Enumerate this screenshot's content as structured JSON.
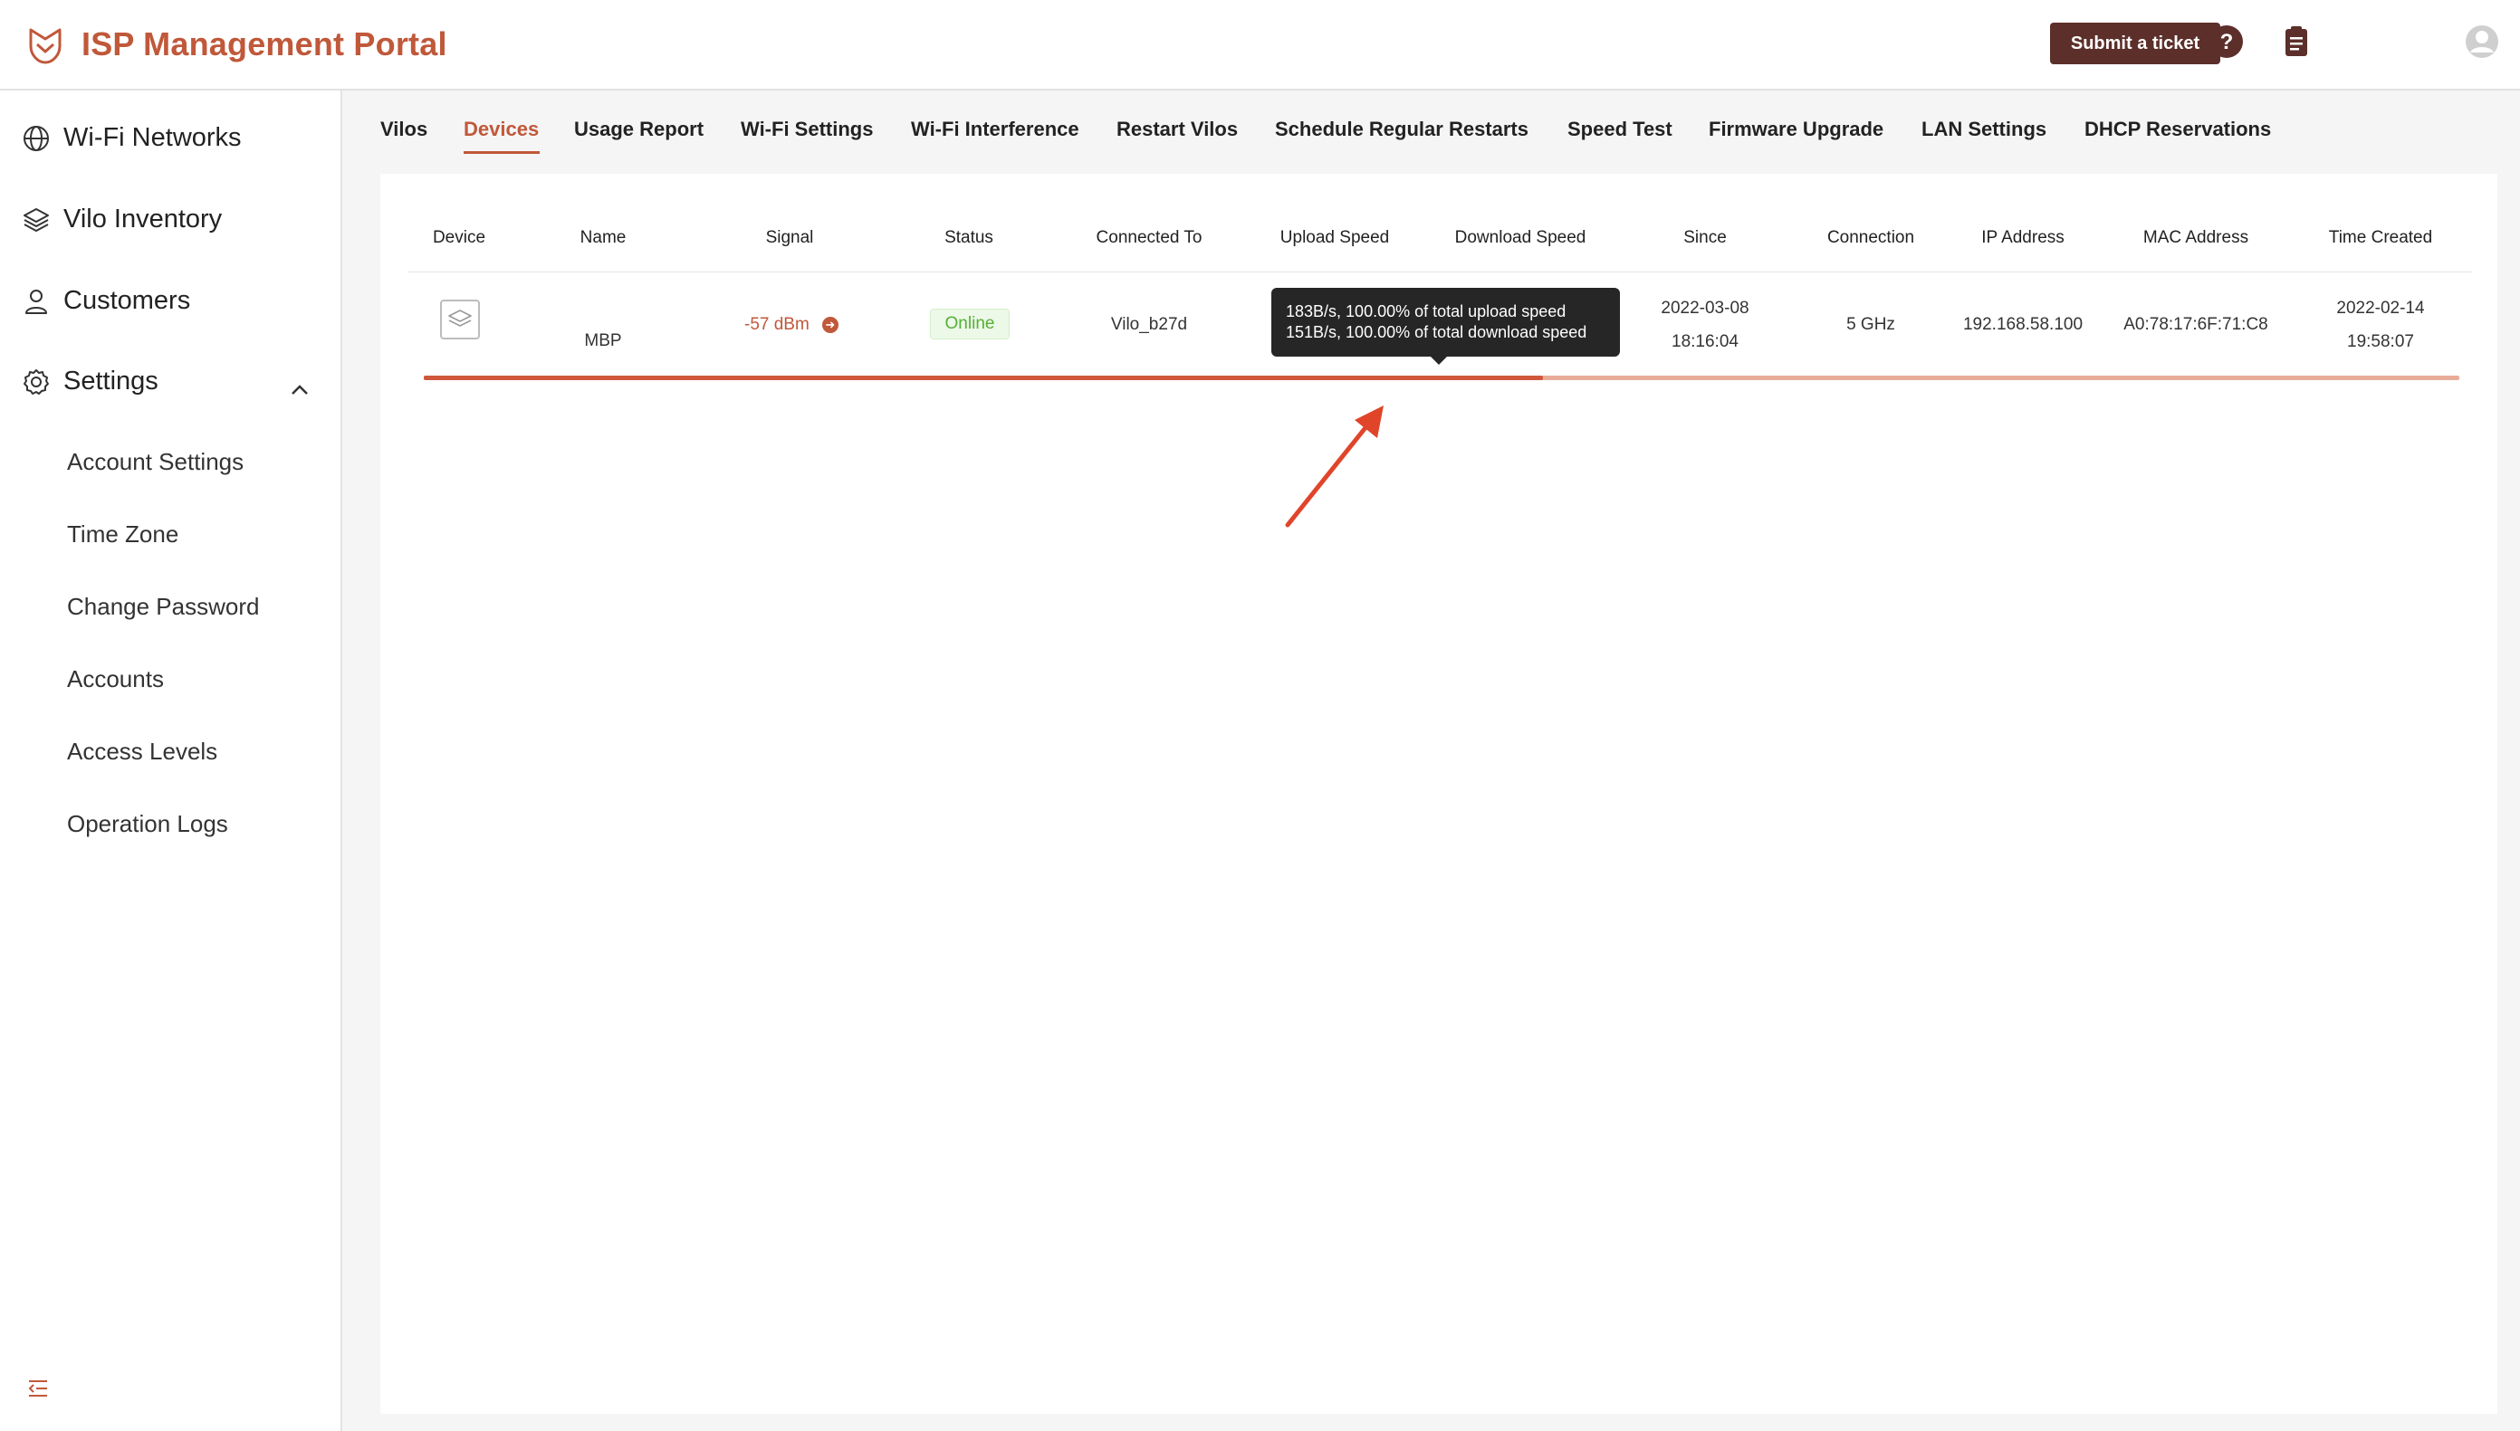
{
  "app": {
    "title": "ISP Management Portal",
    "logo_icon": "fox-logo-icon"
  },
  "header": {
    "submit_ticket_label": "Submit a ticket",
    "icons": [
      "help-circle-icon",
      "clipboard-icon",
      "user-avatar-icon"
    ]
  },
  "sidebar": {
    "items": [
      {
        "label": "Wi-Fi Networks",
        "icon": "globe-icon"
      },
      {
        "label": "Vilo Inventory",
        "icon": "layers-icon"
      },
      {
        "label": "Customers",
        "icon": "person-icon"
      },
      {
        "label": "Settings",
        "icon": "gear-icon",
        "expanded": true
      }
    ],
    "settings_sub": [
      {
        "label": "Account Settings"
      },
      {
        "label": "Time Zone"
      },
      {
        "label": "Change Password"
      },
      {
        "label": "Accounts"
      },
      {
        "label": "Access Levels"
      },
      {
        "label": "Operation Logs"
      }
    ],
    "collapse_icon": "menu-collapse-icon"
  },
  "tabs": {
    "items": [
      {
        "label": "Vilos"
      },
      {
        "label": "Devices",
        "active": true
      },
      {
        "label": "Usage Report"
      },
      {
        "label": "Wi-Fi Settings"
      },
      {
        "label": "Wi-Fi Interference"
      },
      {
        "label": "Restart Vilos"
      },
      {
        "label": "Schedule Regular Restarts"
      },
      {
        "label": "Speed Test"
      },
      {
        "label": "Firmware Upgrade"
      },
      {
        "label": "LAN Settings"
      },
      {
        "label": "DHCP Reservations"
      }
    ]
  },
  "table": {
    "columns": [
      "Device",
      "Name",
      "Signal",
      "Status",
      "Connected To",
      "Upload Speed",
      "Download Speed",
      "Since",
      "Connection",
      "IP Address",
      "MAC Address",
      "Time Created"
    ],
    "rows": [
      {
        "device_icon": "device-layers-icon",
        "name": "MBP",
        "signal": "-57 dBm",
        "status": "Online",
        "connected_to": "Vilo_b27d",
        "since_date": "2022-03-08",
        "since_time": "18:16:04",
        "connection": "5 GHz",
        "ip_address": "192.168.58.100",
        "mac_address": "A0:78:17:6F:71:C8",
        "created_date": "2022-02-14",
        "created_time": "19:58:07"
      }
    ]
  },
  "tooltip": {
    "upload_line": "183B/s, 100.00% of total upload speed",
    "download_line": "151B/s, 100.00% of total download speed"
  },
  "usage_bar": {
    "fill_fraction": 0.55,
    "fill_color": "#cf573a",
    "track_color": "#e8ab99"
  },
  "annotation": {
    "type": "red-arrow-icon",
    "color": "#e0452a"
  },
  "colors": {
    "brand": "#c0583a",
    "ticket_button": "#5c2f2a",
    "online": "#55b034"
  }
}
